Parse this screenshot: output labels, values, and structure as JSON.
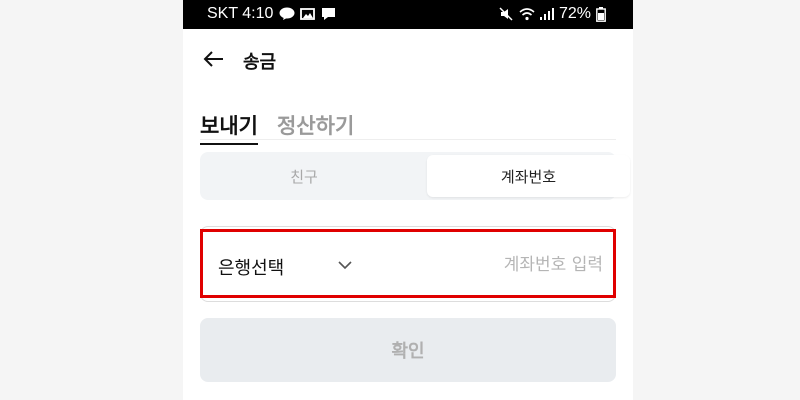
{
  "status_bar": {
    "carrier_time": "SKT 4:10",
    "battery": "72%",
    "icons": [
      "talk-icon",
      "image-icon",
      "chat-icon",
      "mute-icon",
      "wifi-icon",
      "signal-icon",
      "battery-icon"
    ]
  },
  "header": {
    "title": "송금",
    "back_icon": "arrow-left-icon"
  },
  "tabs": [
    {
      "label": "보내기",
      "active": true
    },
    {
      "label": "정산하기",
      "active": false
    }
  ],
  "segment": {
    "friend_label": "친구",
    "account_label": "계좌번호",
    "selected": "계좌번호"
  },
  "account_form": {
    "bank_select_label": "은행선택",
    "account_placeholder": "계좌번호 입력",
    "account_value": ""
  },
  "confirm_button": {
    "label": "확인",
    "enabled": false
  },
  "colors": {
    "highlight": "#e00000",
    "status_bar_bg": "#000000",
    "segment_bg": "#f2f4f6",
    "button_disabled_bg": "#e9ecef"
  }
}
